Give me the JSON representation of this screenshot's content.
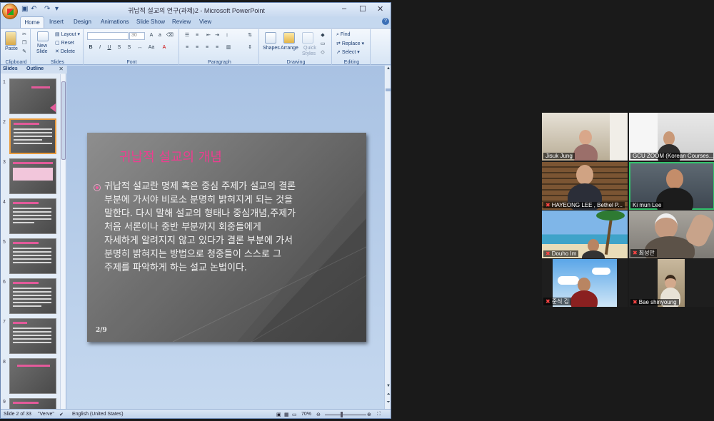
{
  "ppt": {
    "window_title": "귀납적 설교의 연구(과제)2 - Microsoft PowerPoint",
    "tabs": [
      "Home",
      "Insert",
      "Design",
      "Animations",
      "Slide Show",
      "Review",
      "View"
    ],
    "ribbon": {
      "clipboard": {
        "label": "Clipboard",
        "paste": "Paste"
      },
      "slides": {
        "label": "Slides",
        "new_slide_1": "New",
        "new_slide_2": "Slide",
        "layout": "Layout",
        "reset": "Reset",
        "delete": "Delete"
      },
      "font": {
        "label": "Font",
        "size": "30"
      },
      "paragraph": {
        "label": "Paragraph"
      },
      "drawing": {
        "label": "Drawing",
        "shapes": "Shapes",
        "arrange": "Arrange",
        "quick_styles_1": "Quick",
        "quick_styles_2": "Styles"
      },
      "editing": {
        "label": "Editing",
        "find": "Find",
        "replace": "Replace",
        "select": "Select"
      }
    },
    "pane_tabs": {
      "slides": "Slides",
      "outline": "Outline"
    },
    "slide": {
      "title": "귀납적 설교의 개념",
      "body_lines": [
        "귀납적 설교란 명제 혹은 중심 주제가 설교의 결론",
        "부분에 가서야 비로소 분명히 밝혀지게 되는 것을",
        "말한다. 다시 말해 설교의 형태나 중심개념,주제가",
        "처음 서론이나 중반 부분까지 회중들에게",
        "자세하게 알려지지 않고 있다가 결론 부분에 가서",
        "분명히 밝혀지는 방법으로 청중들이 스스로 그",
        "주제를 파악하게 하는 설교 논법이다."
      ],
      "number": "2/9"
    },
    "status": {
      "slide": "Slide 2 of 33",
      "theme": "\"Verve\"",
      "language": "English (United States)",
      "zoom": "70%"
    }
  },
  "zoom": {
    "participants": [
      {
        "name": "Jisuk Jung",
        "muted": false
      },
      {
        "name": "GCU ZOOM (Korean Courses...",
        "muted": false
      },
      {
        "name": "HAYEONG LEE , Bethel P...",
        "muted": true
      },
      {
        "name": "Ki mun Lee",
        "muted": false,
        "active": true
      },
      {
        "name": "Douho Im",
        "muted": true
      },
      {
        "name": "최성만",
        "muted": true
      },
      {
        "name": "준식 김",
        "muted": true
      },
      {
        "name": "Bae shinyoung",
        "muted": true
      }
    ]
  }
}
